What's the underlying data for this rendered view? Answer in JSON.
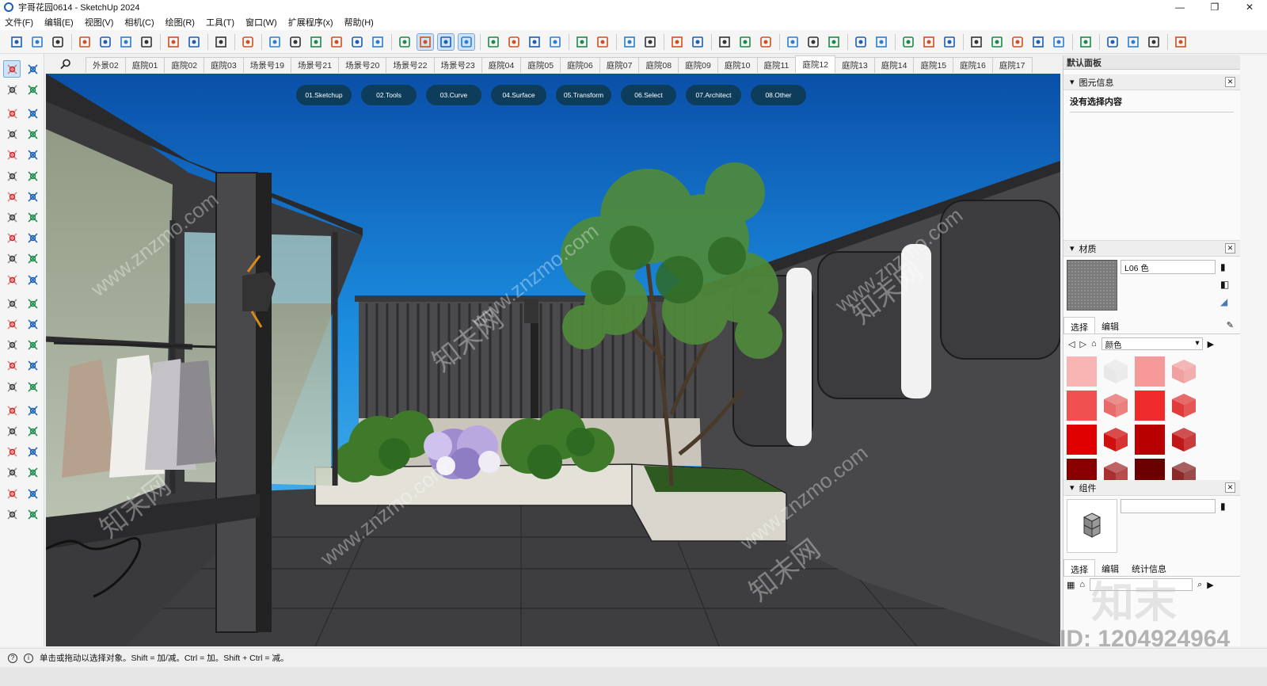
{
  "window": {
    "title": "宇哥花园0614 - SketchUp 2024",
    "minimize": "—",
    "maximize": "❐",
    "close": "✕"
  },
  "menu": [
    "文件(F)",
    "编辑(E)",
    "视图(V)",
    "相机(C)",
    "绘图(R)",
    "工具(T)",
    "窗口(W)",
    "扩展程序(x)",
    "帮助(H)"
  ],
  "scenes": [
    "外景02",
    "庭院01",
    "庭院02",
    "庭院03",
    "场景号19",
    "场景号21",
    "场景号20",
    "场景号22",
    "场景号23",
    "庭院04",
    "庭院05",
    "庭院06",
    "庭院07",
    "庭院08",
    "庭院09",
    "庭院10",
    "庭院11",
    "庭院12",
    "庭院13",
    "庭院14",
    "庭院15",
    "庭院16",
    "庭院17"
  ],
  "active_scene": "庭院12",
  "pills": [
    "01.Sketchup",
    "02.Tools",
    "03.Curve",
    "04.Surface",
    "05.Transform",
    "06.Select",
    "07.Architect",
    "08.Other"
  ],
  "panel": {
    "title": "默认面板",
    "entity_info": {
      "title": "图元信息",
      "empty": "没有选择内容"
    },
    "materials": {
      "title": "材质",
      "name": "L06 色",
      "tab_select": "选择",
      "tab_edit": "编辑",
      "collection": "颜色",
      "swatches": [
        "#f9b4b4",
        "#e8e8e8",
        "#f79999",
        "#f0a0a0",
        "#f05050",
        "#e86a6a",
        "#f02b2b",
        "#e03a3a",
        "#e00000",
        "#d01010",
        "#b80000",
        "#c01818",
        "#8a0000",
        "#a83030",
        "#6a0000",
        "#8a2a2a"
      ]
    },
    "components": {
      "title": "组件",
      "tab_select": "选择",
      "tab_edit": "编辑",
      "tab_stats": "统计信息"
    }
  },
  "status": "单击或拖动以选择对象。Shift = 加/减。Ctrl = 加。Shift + Ctrl = 减。",
  "watermark": {
    "site": "www.znzmo.com",
    "brand": "知末网",
    "logo": "知末",
    "id": "ID: 1204924964"
  }
}
